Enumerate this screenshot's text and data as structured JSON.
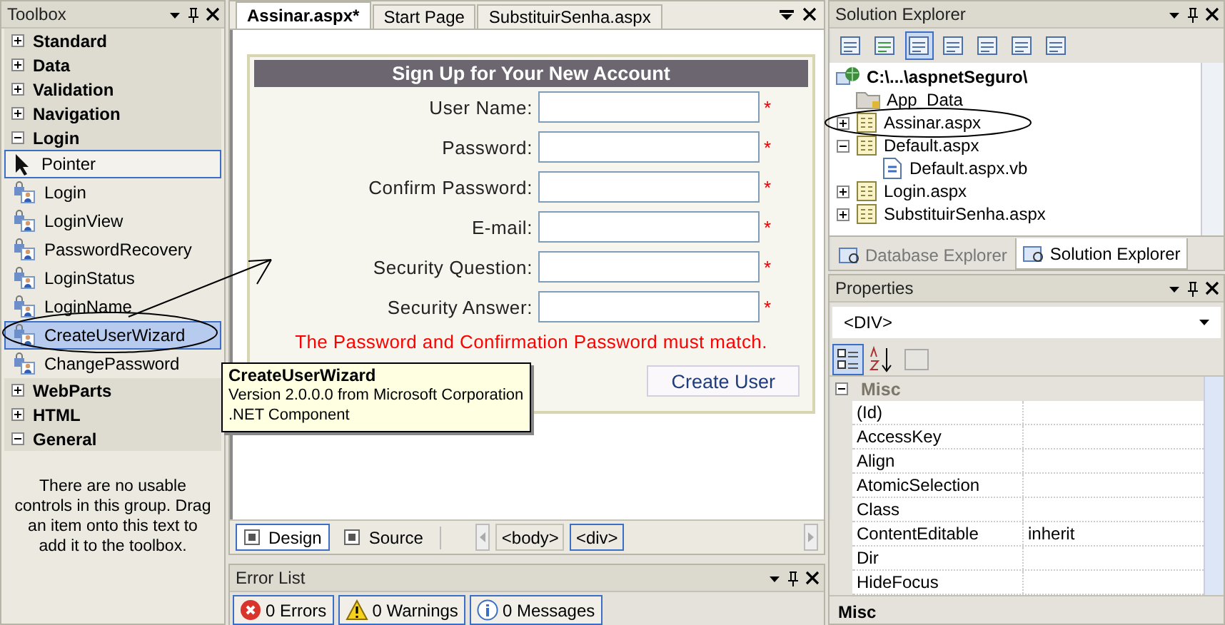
{
  "toolbox": {
    "title": "Toolbox",
    "groups": [
      {
        "label": "Standard",
        "expanded": false
      },
      {
        "label": "Data",
        "expanded": false
      },
      {
        "label": "Validation",
        "expanded": false
      },
      {
        "label": "Navigation",
        "expanded": false
      },
      {
        "label": "Login",
        "expanded": true,
        "items": [
          {
            "label": "Pointer",
            "kind": "pointer",
            "selected": true,
            "highlighted": false
          },
          {
            "label": "Login",
            "kind": "control",
            "selected": false,
            "highlighted": false
          },
          {
            "label": "LoginView",
            "kind": "control",
            "selected": false,
            "highlighted": false
          },
          {
            "label": "PasswordRecovery",
            "kind": "control",
            "selected": false,
            "highlighted": false
          },
          {
            "label": "LoginStatus",
            "kind": "control",
            "selected": false,
            "highlighted": false
          },
          {
            "label": "LoginName",
            "kind": "control",
            "selected": false,
            "highlighted": false
          },
          {
            "label": "CreateUserWizard",
            "kind": "control",
            "selected": false,
            "highlighted": true
          },
          {
            "label": "ChangePassword",
            "kind": "control",
            "selected": false,
            "highlighted": false
          }
        ]
      },
      {
        "label": "WebParts",
        "expanded": false
      },
      {
        "label": "HTML",
        "expanded": false
      },
      {
        "label": "General",
        "expanded": true,
        "message": "There are no usable controls in this group. Drag an item onto this text to add it to the toolbox."
      }
    ]
  },
  "tooltip": {
    "title": "CreateUserWizard",
    "lines": [
      "Version 2.0.0.0 from Microsoft Corporation",
      ".NET Component"
    ]
  },
  "editor": {
    "tabs": [
      {
        "label": "Assinar.aspx*",
        "selected": true
      },
      {
        "label": "Start Page",
        "selected": false
      },
      {
        "label": "SubstituirSenha.aspx",
        "selected": false
      }
    ],
    "form": {
      "title": "Sign Up for Your New Account",
      "fields": [
        {
          "label": "User Name:",
          "required_mark": "*"
        },
        {
          "label": "Password:",
          "required_mark": "*"
        },
        {
          "label": "Confirm Password:",
          "required_mark": "*"
        },
        {
          "label": "E-mail:",
          "required_mark": "*"
        },
        {
          "label": "Security Question:",
          "required_mark": "*"
        },
        {
          "label": "Security Answer:",
          "required_mark": "*"
        }
      ],
      "error": "The Password and Confirmation Password must match.",
      "button": "Create User"
    },
    "views": [
      {
        "label": "Design",
        "selected": true
      },
      {
        "label": "Source",
        "selected": false
      }
    ],
    "breadcrumbs": [
      {
        "label": "<body>",
        "selected": false
      },
      {
        "label": "<div>",
        "selected": true
      }
    ]
  },
  "error_list": {
    "title": "Error List",
    "buttons": [
      {
        "label": "0 Errors",
        "kind": "error"
      },
      {
        "label": "0 Warnings",
        "kind": "warning"
      },
      {
        "label": "0 Messages",
        "kind": "message"
      }
    ]
  },
  "solution_explorer": {
    "title": "Solution Explorer",
    "root": {
      "label": "C:\\...\\aspnetSeguro\\",
      "kind": "project",
      "children": [
        {
          "label": "App_Data",
          "kind": "folder"
        },
        {
          "label": "Assinar.aspx",
          "kind": "page",
          "expanded": false
        },
        {
          "label": "Default.aspx",
          "kind": "page",
          "expanded": true,
          "children": [
            {
              "label": "Default.aspx.vb",
              "kind": "code"
            }
          ]
        },
        {
          "label": "Login.aspx",
          "kind": "page",
          "expanded": false
        },
        {
          "label": "SubstituirSenha.aspx",
          "kind": "page",
          "expanded": false
        }
      ]
    },
    "tabs": [
      {
        "label": "Database Explorer",
        "selected": false
      },
      {
        "label": "Solution Explorer",
        "selected": true
      }
    ]
  },
  "properties": {
    "title": "Properties",
    "object": "<DIV>",
    "category": {
      "label": "Misc",
      "expanded": true
    },
    "rows": [
      {
        "name": "(Id)"
      },
      {
        "name": "AccessKey"
      },
      {
        "name": "Align"
      },
      {
        "name": "AtomicSelection"
      },
      {
        "name": "Class"
      },
      {
        "name": "ContentEditable",
        "value": "inherit"
      },
      {
        "name": "Dir"
      },
      {
        "name": "HideFocus"
      }
    ],
    "description": "Misc"
  }
}
